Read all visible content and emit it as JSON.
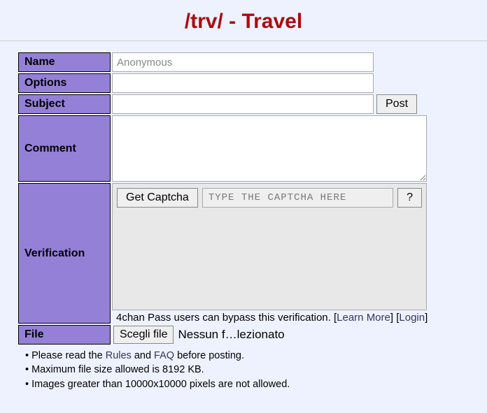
{
  "header": {
    "title": "/trv/ - Travel"
  },
  "form": {
    "name": {
      "label": "Name",
      "placeholder": "Anonymous",
      "value": ""
    },
    "options": {
      "label": "Options",
      "value": ""
    },
    "subject": {
      "label": "Subject",
      "value": "",
      "post_button": "Post"
    },
    "comment": {
      "label": "Comment",
      "value": ""
    },
    "verification": {
      "label": "Verification",
      "get_captcha": "Get Captcha",
      "captcha_placeholder": "TYPE THE CAPTCHA HERE",
      "help": "?",
      "note_prefix": "4chan Pass users can bypass this verification. [",
      "learn_more": "Learn More",
      "mid": "] [",
      "login": "Login",
      "suffix": "]"
    },
    "file": {
      "label": "File",
      "choose_button": "Scegli file",
      "status": "Nessun f…lezionato"
    }
  },
  "notes": {
    "line1_a": "• Please read the ",
    "rules": "Rules",
    "line1_b": " and ",
    "faq": "FAQ",
    "line1_c": " before posting.",
    "line2": "• Maximum file size allowed is 8192 KB.",
    "line3": "• Images greater than 10000x10000 pixels are not allowed."
  }
}
